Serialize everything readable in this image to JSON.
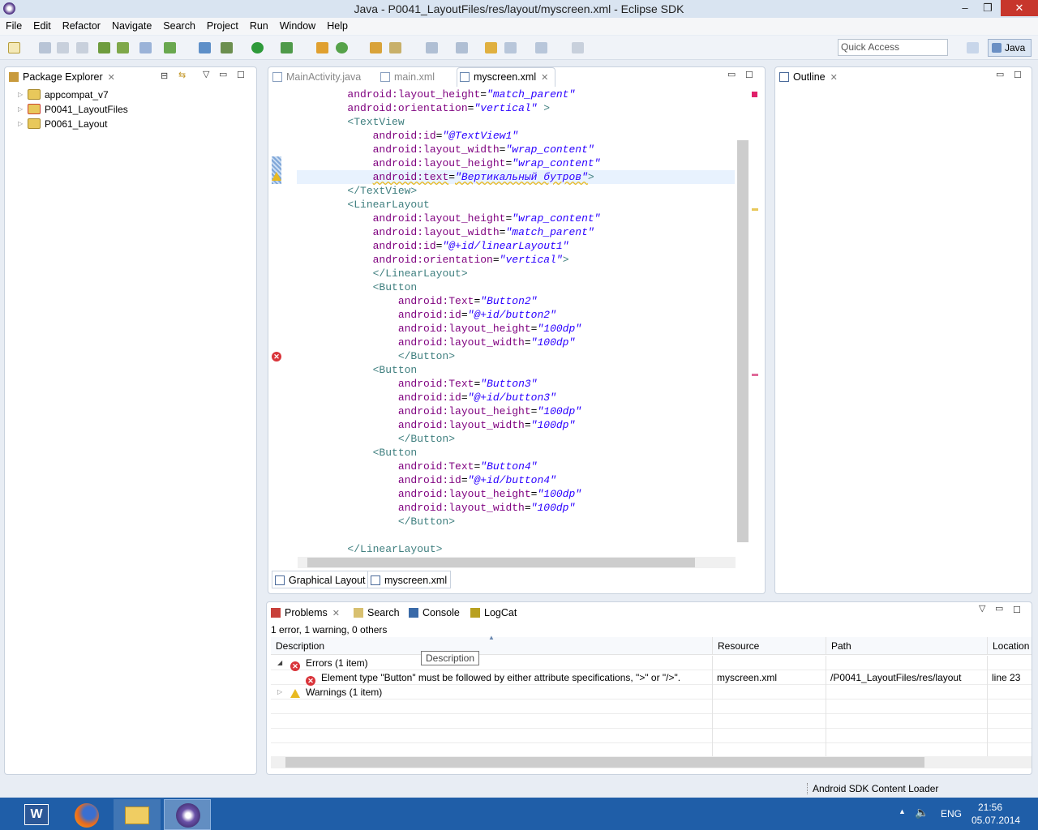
{
  "window": {
    "title": "Java - P0041_LayoutFiles/res/layout/myscreen.xml - Eclipse SDK",
    "minimize": "‒",
    "maximize": "❐",
    "close": "✕"
  },
  "menu": [
    "File",
    "Edit",
    "Refactor",
    "Navigate",
    "Search",
    "Project",
    "Run",
    "Window",
    "Help"
  ],
  "toolbar": {
    "quick_access_placeholder": "Quick Access",
    "perspective": "Java"
  },
  "package_explorer": {
    "title": "Package Explorer",
    "items": [
      "appcompat_v7",
      "P0041_LayoutFiles",
      "P0061_Layout"
    ]
  },
  "editor": {
    "tabs": [
      {
        "label": "MainActivity.java",
        "active": false
      },
      {
        "label": "main.xml",
        "active": false
      },
      {
        "label": "myscreen.xml",
        "active": true
      }
    ],
    "bottom_tabs": [
      "Graphical Layout",
      "myscreen.xml"
    ],
    "highlighted_line": 7,
    "warning_line": 7,
    "error_line": 20,
    "lines": [
      [
        2,
        [
          [
            "a",
            "android:layout_height"
          ],
          [
            "p",
            "="
          ],
          [
            "v",
            "\"match_parent\""
          ]
        ]
      ],
      [
        2,
        [
          [
            "a",
            "android:orientation"
          ],
          [
            "p",
            "="
          ],
          [
            "v",
            "\"vertical\""
          ],
          [
            "t",
            " >"
          ]
        ]
      ],
      [
        2,
        [
          [
            "t",
            "<TextView"
          ]
        ]
      ],
      [
        3,
        [
          [
            "a",
            "android:id"
          ],
          [
            "p",
            "="
          ],
          [
            "v",
            "\"@TextView1\""
          ]
        ]
      ],
      [
        3,
        [
          [
            "a",
            "android:layout_width"
          ],
          [
            "p",
            "="
          ],
          [
            "v",
            "\"wrap_content\""
          ]
        ]
      ],
      [
        3,
        [
          [
            "a",
            "android:layout_height"
          ],
          [
            "p",
            "="
          ],
          [
            "v",
            "\"wrap_content\""
          ]
        ]
      ],
      [
        3,
        [
          [
            "a",
            "android:text"
          ],
          [
            "p",
            "="
          ],
          [
            "v",
            "\"Вертикальный бутров\""
          ],
          [
            "t",
            ">"
          ]
        ]
      ],
      [
        2,
        [
          [
            "t",
            "</TextView>"
          ]
        ]
      ],
      [
        2,
        [
          [
            "t",
            "<LinearLayout"
          ]
        ]
      ],
      [
        3,
        [
          [
            "a",
            "android:layout_height"
          ],
          [
            "p",
            "="
          ],
          [
            "v",
            "\"wrap_content\""
          ]
        ]
      ],
      [
        3,
        [
          [
            "a",
            "android:layout_width"
          ],
          [
            "p",
            "="
          ],
          [
            "v",
            "\"match_parent\""
          ]
        ]
      ],
      [
        3,
        [
          [
            "a",
            "android:id"
          ],
          [
            "p",
            "="
          ],
          [
            "v",
            "\"@+id/linearLayout1\""
          ]
        ]
      ],
      [
        3,
        [
          [
            "a",
            "android:orientation"
          ],
          [
            "p",
            "="
          ],
          [
            "v",
            "\"vertical\""
          ],
          [
            "t",
            ">"
          ]
        ]
      ],
      [
        3,
        [
          [
            "t",
            "</LinearLayout>"
          ]
        ]
      ],
      [
        3,
        [
          [
            "t",
            "<Button"
          ]
        ]
      ],
      [
        4,
        [
          [
            "a",
            "android:Text"
          ],
          [
            "p",
            "="
          ],
          [
            "v",
            "\"Button2\""
          ]
        ]
      ],
      [
        4,
        [
          [
            "a",
            "android:id"
          ],
          [
            "p",
            "="
          ],
          [
            "v",
            "\"@+id/button2\""
          ]
        ]
      ],
      [
        4,
        [
          [
            "a",
            "android:layout_height"
          ],
          [
            "p",
            "="
          ],
          [
            "v",
            "\"100dp\""
          ]
        ]
      ],
      [
        4,
        [
          [
            "a",
            "android:layout_width"
          ],
          [
            "p",
            "="
          ],
          [
            "v",
            "\"100dp\""
          ]
        ]
      ],
      [
        4,
        [
          [
            "t",
            "</Button>"
          ]
        ]
      ],
      [
        3,
        [
          [
            "t",
            "<Button"
          ]
        ]
      ],
      [
        4,
        [
          [
            "a",
            "android:Text"
          ],
          [
            "p",
            "="
          ],
          [
            "v",
            "\"Button3\""
          ]
        ]
      ],
      [
        4,
        [
          [
            "a",
            "android:id"
          ],
          [
            "p",
            "="
          ],
          [
            "v",
            "\"@+id/button3\""
          ]
        ]
      ],
      [
        4,
        [
          [
            "a",
            "android:layout_height"
          ],
          [
            "p",
            "="
          ],
          [
            "v",
            "\"100dp\""
          ]
        ]
      ],
      [
        4,
        [
          [
            "a",
            "android:layout_width"
          ],
          [
            "p",
            "="
          ],
          [
            "v",
            "\"100dp\""
          ]
        ]
      ],
      [
        4,
        [
          [
            "t",
            "</Button>"
          ]
        ]
      ],
      [
        3,
        [
          [
            "t",
            "<Button"
          ]
        ]
      ],
      [
        4,
        [
          [
            "a",
            "android:Text"
          ],
          [
            "p",
            "="
          ],
          [
            "v",
            "\"Button4\""
          ]
        ]
      ],
      [
        4,
        [
          [
            "a",
            "android:id"
          ],
          [
            "p",
            "="
          ],
          [
            "v",
            "\"@+id/button4\""
          ]
        ]
      ],
      [
        4,
        [
          [
            "a",
            "android:layout_height"
          ],
          [
            "p",
            "="
          ],
          [
            "v",
            "\"100dp\""
          ]
        ]
      ],
      [
        4,
        [
          [
            "a",
            "android:layout_width"
          ],
          [
            "p",
            "="
          ],
          [
            "v",
            "\"100dp\""
          ]
        ]
      ],
      [
        4,
        [
          [
            "t",
            "</Button>"
          ]
        ]
      ],
      [
        0,
        []
      ],
      [
        2,
        [
          [
            "t",
            "</LinearLayout>"
          ]
        ]
      ]
    ]
  },
  "outline": {
    "title": "Outline"
  },
  "bottom_panel": {
    "tabs": [
      "Problems",
      "Search",
      "Console",
      "LogCat"
    ],
    "summary": "1 error, 1 warning, 0 others",
    "columns": [
      "Description",
      "Resource",
      "Path",
      "Location"
    ],
    "tooltip": "Description",
    "groups": [
      {
        "label": "Errors (1 item)",
        "expanded": true,
        "items": [
          {
            "description": "Element type \"Button\" must be followed by either attribute specifications, \">\" or \"/>\".",
            "resource": "myscreen.xml",
            "path": "/P0041_LayoutFiles/res/layout",
            "location": "line 23"
          }
        ]
      },
      {
        "label": "Warnings (1 item)",
        "expanded": false
      }
    ]
  },
  "status": {
    "text": "Android SDK Content Loader"
  },
  "taskbar": {
    "apps": [
      "word",
      "firefox",
      "file-explorer",
      "eclipse"
    ],
    "lang": "ENG",
    "time": "21:56",
    "date": "05.07.2014"
  },
  "colors": {
    "attr": "#7f007f",
    "value": "#2a00ff",
    "tag": "#3f7f7f",
    "error": "#d9343a",
    "warning": "#e8b920",
    "taskbar": "#1f5ea8"
  }
}
